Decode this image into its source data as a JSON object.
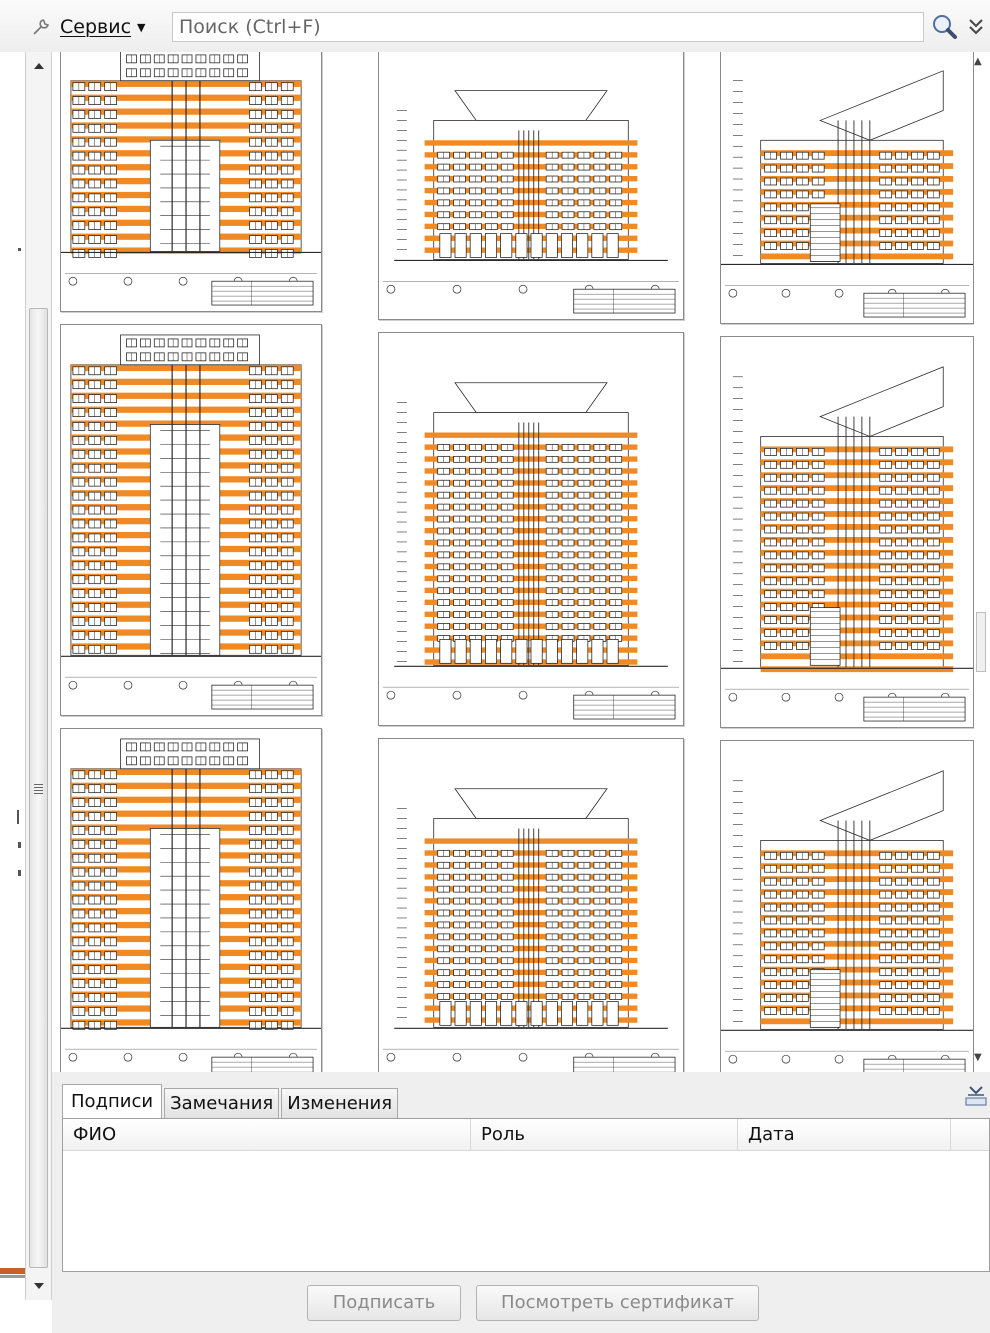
{
  "toolbar": {
    "tools_label": "Сервис",
    "search_placeholder": "Поиск (Ctrl+F)"
  },
  "tabs": [
    {
      "label": "Подписи",
      "active": true
    },
    {
      "label": "Замечания",
      "active": false
    },
    {
      "label": "Изменения",
      "active": false
    }
  ],
  "signatures_table": {
    "columns": [
      "ФИО",
      "Роль",
      "Дата"
    ],
    "rows": []
  },
  "buttons": {
    "sign": "Подписать",
    "view_certificate": "Посмотреть сертификат"
  },
  "colors": {
    "drawing_accent": "#f08a24",
    "drawing_line": "#2a2a2a"
  },
  "icons": {
    "tools": "wrench-icon",
    "search": "search-icon",
    "more": "double-chevron-down-icon",
    "collapse_panel": "collapse-panel-icon"
  },
  "thumbnails": [
    {
      "name": "elevation-sheet-1",
      "kind": "side"
    },
    {
      "name": "elevation-sheet-2",
      "kind": "front"
    },
    {
      "name": "elevation-sheet-3",
      "kind": "step"
    },
    {
      "name": "elevation-sheet-4",
      "kind": "side"
    },
    {
      "name": "elevation-sheet-5",
      "kind": "front"
    },
    {
      "name": "elevation-sheet-6",
      "kind": "step"
    },
    {
      "name": "elevation-sheet-7",
      "kind": "side"
    },
    {
      "name": "elevation-sheet-8",
      "kind": "front"
    },
    {
      "name": "elevation-sheet-9",
      "kind": "step"
    }
  ]
}
